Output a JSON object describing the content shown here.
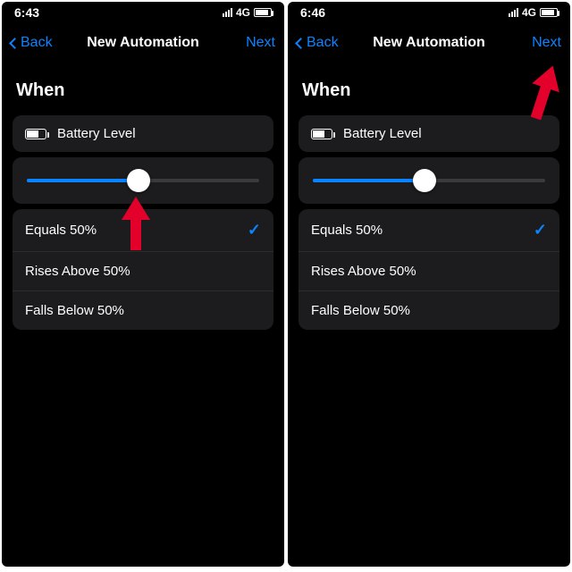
{
  "left": {
    "status": {
      "time": "6:43",
      "network": "4G"
    },
    "nav": {
      "back": "Back",
      "title": "New Automation",
      "next": "Next"
    },
    "section_when": "When",
    "trigger": {
      "label": "Battery Level"
    },
    "slider": {
      "percent": 50
    },
    "options": {
      "equals": "Equals 50%",
      "rises": "Rises Above 50%",
      "falls": "Falls Below 50%",
      "selected": "equals"
    }
  },
  "right": {
    "status": {
      "time": "6:46",
      "network": "4G"
    },
    "nav": {
      "back": "Back",
      "title": "New Automation",
      "next": "Next"
    },
    "section_when": "When",
    "trigger": {
      "label": "Battery Level"
    },
    "slider": {
      "percent": 50
    },
    "options": {
      "equals": "Equals 50%",
      "rises": "Rises Above 50%",
      "falls": "Falls Below 50%",
      "selected": "equals"
    }
  }
}
